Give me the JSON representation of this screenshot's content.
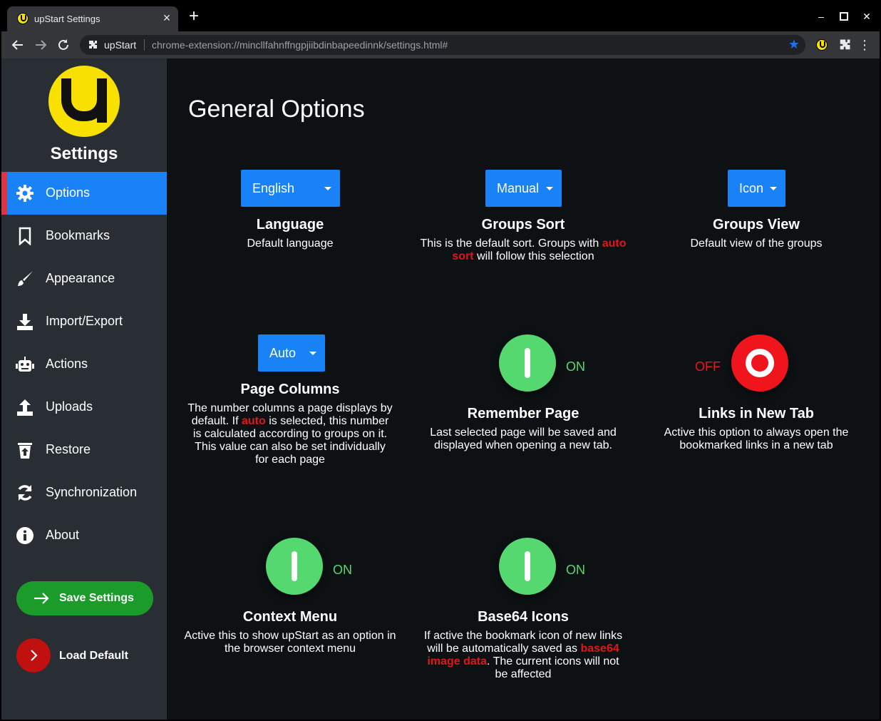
{
  "browser": {
    "tab_title": "upStart Settings",
    "site_name": "upStart",
    "url": "chrome-extension://mincllfahnffngpjiibdinbapeedinnk/settings.html#"
  },
  "sidebar": {
    "title": "Settings",
    "items": [
      {
        "label": "Options",
        "icon": "gear-icon"
      },
      {
        "label": "Bookmarks",
        "icon": "bookmark-icon"
      },
      {
        "label": "Appearance",
        "icon": "brush-icon"
      },
      {
        "label": "Import/Export",
        "icon": "download-icon"
      },
      {
        "label": "Actions",
        "icon": "robot-icon"
      },
      {
        "label": "Uploads",
        "icon": "upload-icon"
      },
      {
        "label": "Restore",
        "icon": "trash-restore-icon"
      },
      {
        "label": "Synchronization",
        "icon": "sync-icon"
      },
      {
        "label": "About",
        "icon": "info-icon"
      }
    ],
    "save_label": "Save Settings",
    "load_label": "Load Default"
  },
  "main": {
    "title": "General Options",
    "language": {
      "value": "English",
      "title": "Language",
      "desc": "Default language"
    },
    "groups_sort": {
      "value": "Manual",
      "title": "Groups Sort",
      "desc_1": "This is the default sort. Groups with",
      "desc_highlight": "auto sort",
      "desc_2": "will follow this selection"
    },
    "groups_view": {
      "value": "Icon",
      "title": "Groups View",
      "desc": "Default view of the groups"
    },
    "page_columns": {
      "value": "Auto",
      "title": "Page Columns",
      "desc_1": "The number columns a page displays by default. If",
      "desc_highlight": "auto",
      "desc_2": "is selected, this number is calculated according to groups on it. This value can also be set individually for each page"
    },
    "remember_page": {
      "state": "ON",
      "title": "Remember Page",
      "desc": "Last selected page will be saved and displayed when opening a new tab."
    },
    "links_new_tab": {
      "state": "OFF",
      "title": "Links in New Tab",
      "desc": "Active this option to always open the bookmarked links in a new tab"
    },
    "context_menu": {
      "state": "ON",
      "title": "Context Menu",
      "desc": "Active this to show upStart as an option in the browser context menu"
    },
    "base64_icons": {
      "state": "ON",
      "title": "Base64 Icons",
      "desc_1": "If active the bookmark icon of new links will be automatically saved as",
      "desc_highlight": "base64 image data",
      "desc_2": ". The current icons will not be affected"
    }
  },
  "colors": {
    "accent": "#1a82f7",
    "active_marker": "#dc3545",
    "on": "#55d86f",
    "off": "#f0141c",
    "save": "#1a9b2a",
    "load": "#c01010",
    "logo": "#f8e000"
  }
}
